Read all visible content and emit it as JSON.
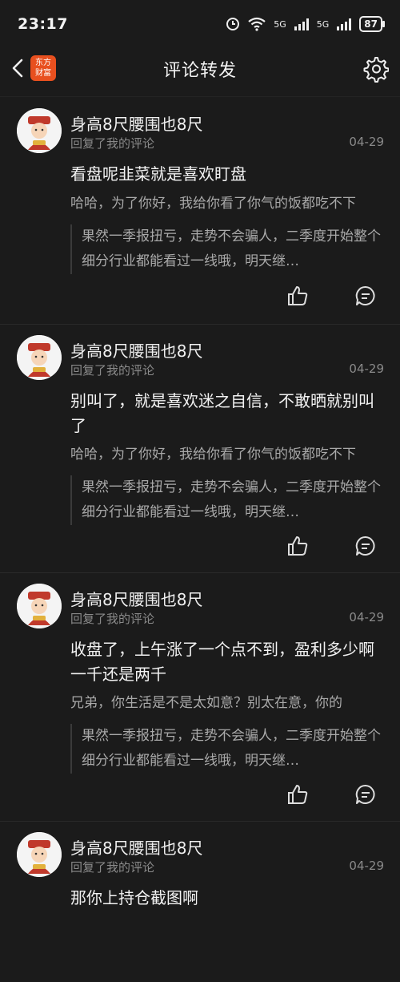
{
  "status": {
    "time": "23:17",
    "battery": "87",
    "net1": "5G",
    "net2": "5G"
  },
  "nav": {
    "title": "评论转发",
    "logo_top": "东方",
    "logo_bottom": "财富"
  },
  "cards": [
    {
      "username": "身高8尺腰围也8尺",
      "subline": "回复了我的评论",
      "date": "04-29",
      "comment": "看盘呢韭菜就是喜欢盯盘",
      "reply": "哈哈，为了你好，我给你看了你气的饭都吃不下",
      "quote": "果然一季报扭亏，走势不会骗人，二季度开始整个细分行业都能看过一线哦，明天继…"
    },
    {
      "username": "身高8尺腰围也8尺",
      "subline": "回复了我的评论",
      "date": "04-29",
      "comment": "别叫了，就是喜欢迷之自信，不敢晒就别叫了",
      "reply": "哈哈，为了你好，我给你看了你气的饭都吃不下",
      "quote": "果然一季报扭亏，走势不会骗人，二季度开始整个细分行业都能看过一线哦，明天继…"
    },
    {
      "username": "身高8尺腰围也8尺",
      "subline": "回复了我的评论",
      "date": "04-29",
      "comment": "收盘了，上午涨了一个点不到，盈利多少啊一千还是两千",
      "reply": "兄弟，你生活是不是太如意？别太在意，你的",
      "quote": "果然一季报扭亏，走势不会骗人，二季度开始整个细分行业都能看过一线哦，明天继…"
    },
    {
      "username": "身高8尺腰围也8尺",
      "subline": "回复了我的评论",
      "date": "04-29",
      "comment": "那你上持仓截图啊"
    }
  ]
}
